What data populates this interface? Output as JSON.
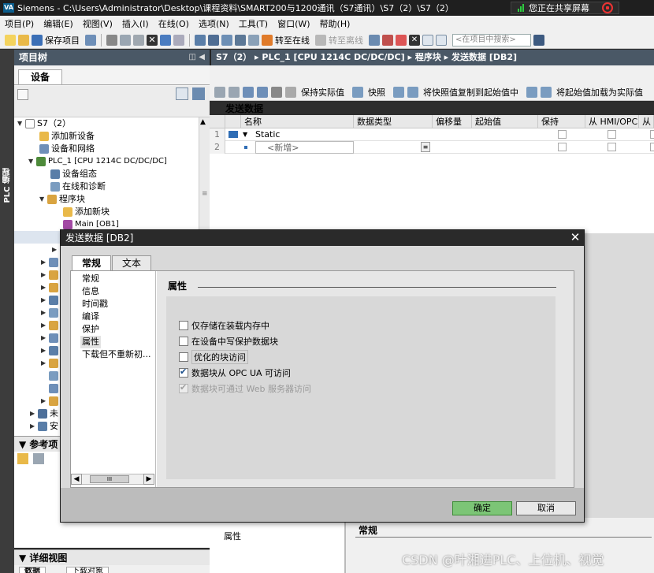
{
  "window": {
    "title": "Siemens  -  C:\\Users\\Administrator\\Desktop\\课程资料\\SMART200与1200通讯（S7通讯）\\S7（2）\\S7（2）",
    "logo_text": "VA",
    "share_text": "您正在共享屏幕"
  },
  "menu": [
    "项目(P)",
    "编辑(E)",
    "视图(V)",
    "插入(I)",
    "在线(O)",
    "选项(N)",
    "工具(T)",
    "窗口(W)",
    "帮助(H)"
  ],
  "toolbar": {
    "save_label": "保存项目",
    "online_label": "转至在线",
    "offline_label": "转至离线",
    "search_placeholder": "<在项目中搜索>"
  },
  "project_tree": {
    "header": "项目树",
    "tab": "设备",
    "side_tab": "PLC 编程",
    "items": [
      {
        "label": "S7（2）"
      },
      {
        "label": "添加新设备"
      },
      {
        "label": "设备和网络"
      },
      {
        "label": "PLC_1 [CPU 1214C DC/DC/DC]"
      },
      {
        "label": "设备组态"
      },
      {
        "label": "在线和诊断"
      },
      {
        "label": "程序块"
      },
      {
        "label": "添加新块"
      },
      {
        "label": "Main [OB1]"
      }
    ],
    "stubs": [
      "未",
      "安"
    ]
  },
  "reference_panel": {
    "header": "参考项"
  },
  "detail_panel": {
    "header": "详细视图",
    "tabs": [
      "数据",
      "下载对象"
    ]
  },
  "editor": {
    "breadcrumb": "S7（2） ▸ PLC_1 [CPU 1214C DC/DC/DC] ▸ 程序块 ▸ 发送数据 [DB2]",
    "toolbar_labels": [
      "保持实际值",
      "快照",
      "将快照值复制到起始值中",
      "将起始值加载为实际值"
    ],
    "block_title": "发送数据",
    "columns": [
      "名称",
      "数据类型",
      "偏移量",
      "起始值",
      "保持",
      "从 HMI/OPC...",
      "从"
    ],
    "rows": [
      {
        "num": "1",
        "name": "Static"
      },
      {
        "num": "2",
        "name": "<新增>"
      }
    ],
    "properties_label": "属性",
    "general_label": "常规"
  },
  "dialog": {
    "title": "发送数据 [DB2]",
    "tabs": [
      "常规",
      "文本"
    ],
    "nav": [
      "常规",
      "信息",
      "时间戳",
      "编译",
      "保护",
      "属性",
      "下载但不重新初..."
    ],
    "section_title": "属性",
    "options": [
      {
        "label": "仅存储在装载内存中",
        "checked": false,
        "enabled": true
      },
      {
        "label": "在设备中写保护数据块",
        "checked": false,
        "enabled": true
      },
      {
        "label": "优化的块访问",
        "checked": false,
        "enabled": true
      },
      {
        "label": "数据块从 OPC UA 可访问",
        "checked": true,
        "enabled": true
      },
      {
        "label": "数据块可通过 Web 服务器访问",
        "checked": true,
        "enabled": false
      }
    ],
    "ok_label": "确定",
    "cancel_label": "取消"
  },
  "watermark": "CSDN @叶湘进PLC、上位机、视觉"
}
